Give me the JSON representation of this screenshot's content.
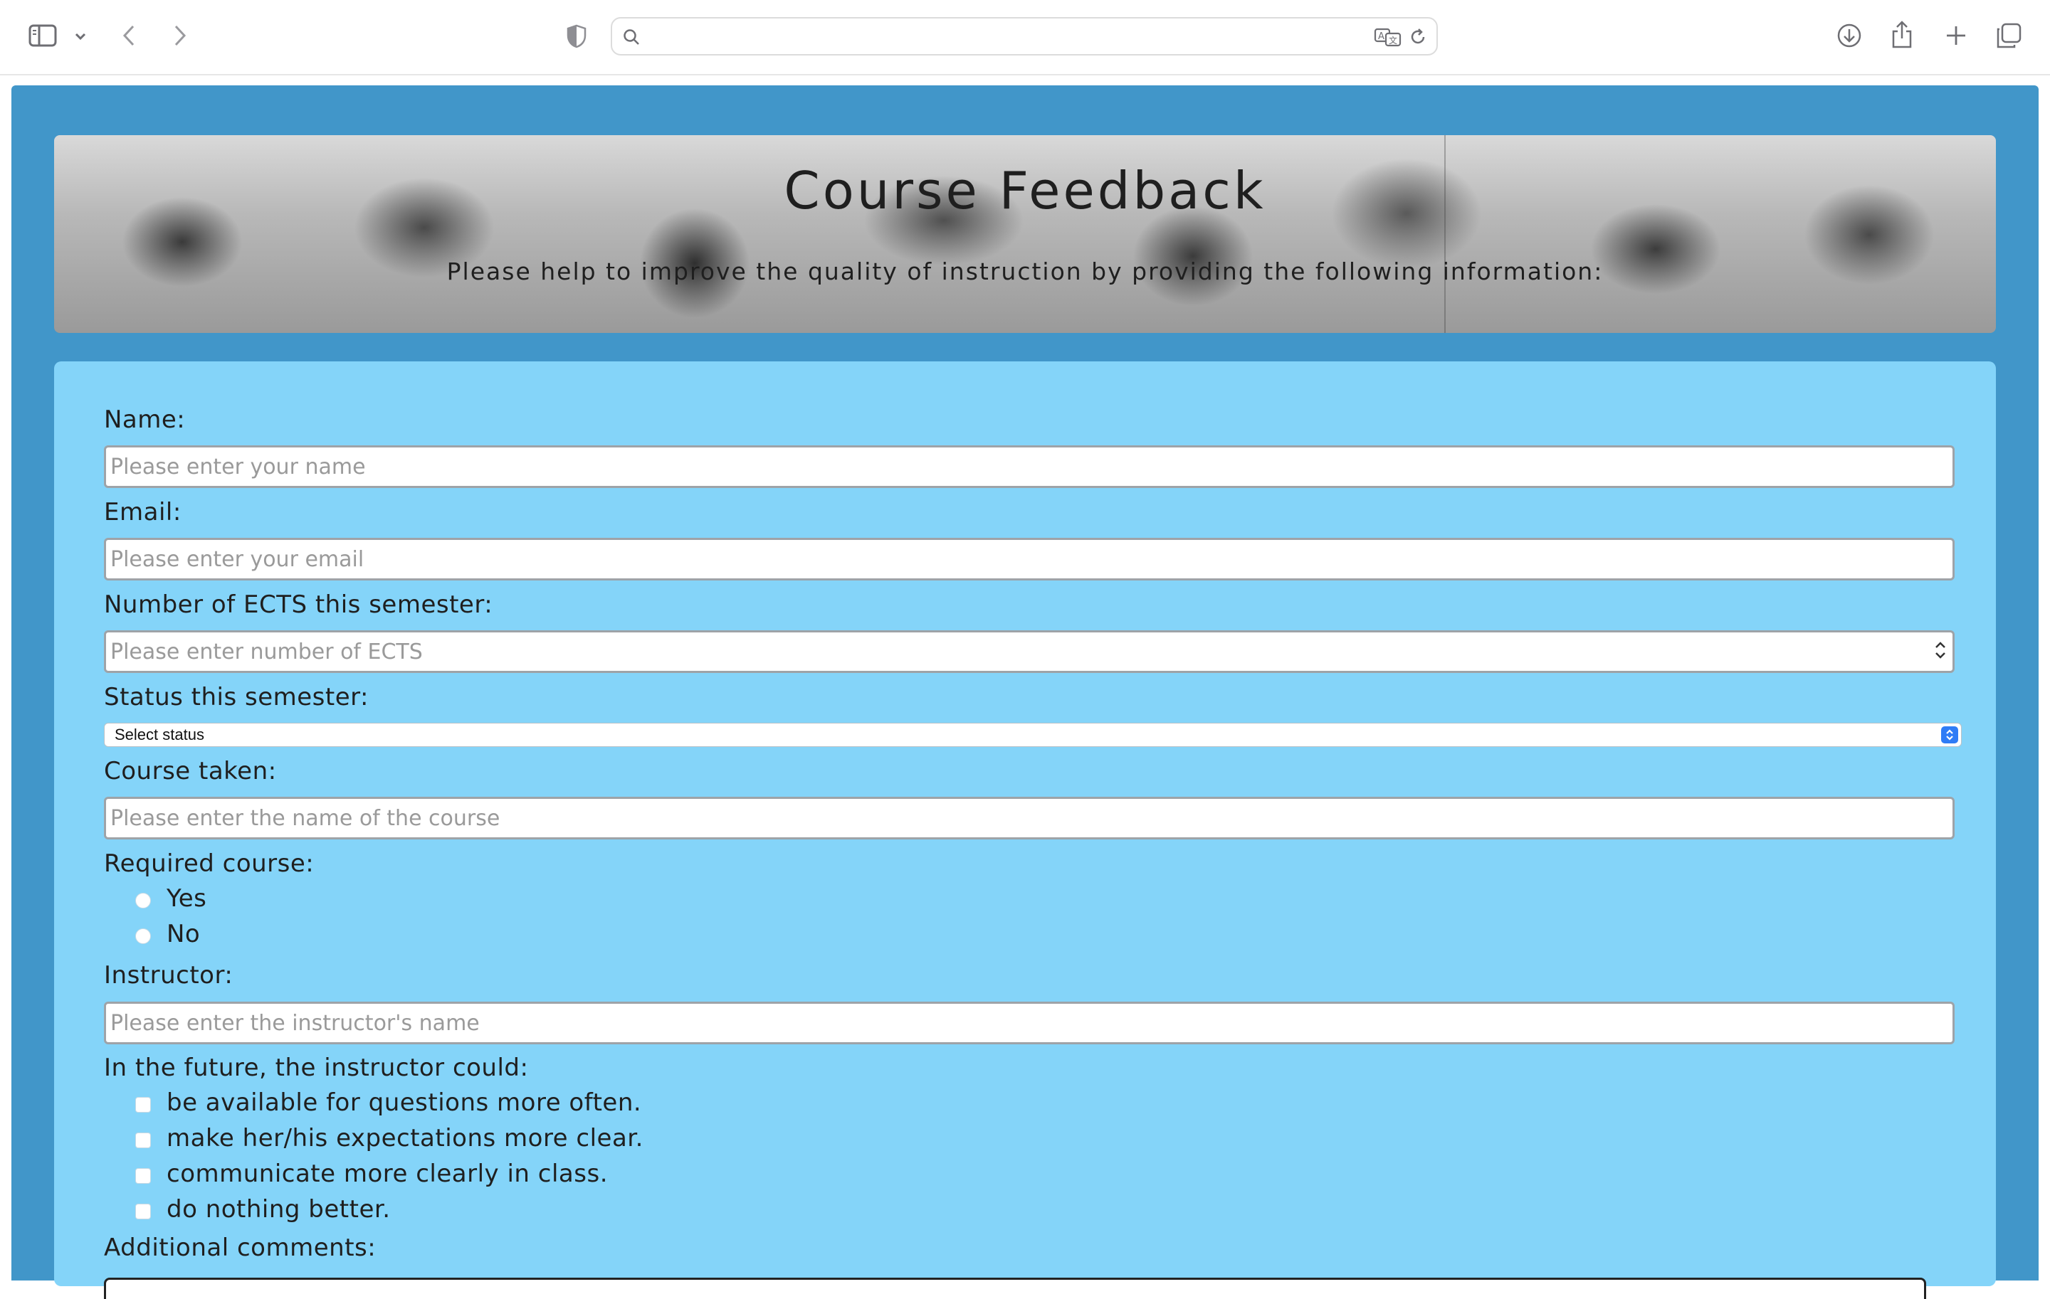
{
  "browser": {
    "address_value": "",
    "icons": [
      "sidebar-icon",
      "chevron-down-icon",
      "back-icon",
      "forward-icon",
      "shield-icon",
      "search-icon",
      "translate-icon",
      "reload-icon",
      "download-icon",
      "share-icon",
      "plus-icon",
      "tabs-icon"
    ]
  },
  "header": {
    "title": "Course Feedback",
    "subtitle": "Please help to improve the quality of instruction by providing the following information:"
  },
  "form": {
    "name": {
      "label": "Name:",
      "placeholder": "Please enter your name"
    },
    "email": {
      "label": "Email:",
      "placeholder": "Please enter your email"
    },
    "ects": {
      "label": "Number of ECTS this semester:",
      "placeholder": "Please enter number of ECTS"
    },
    "status": {
      "label": "Status this semester:",
      "selected": "Select status"
    },
    "course": {
      "label": "Course taken:",
      "placeholder": "Please enter the name of the course"
    },
    "required": {
      "label": "Required course:",
      "options": [
        "Yes",
        "No"
      ]
    },
    "instructor": {
      "label": "Instructor:",
      "placeholder": "Please enter the instructor's name"
    },
    "future": {
      "label": "In the future, the instructor could:",
      "options": [
        "be available for questions more often.",
        "make her/his expectations more clear.",
        "communicate more clearly in class.",
        "do nothing better."
      ]
    },
    "comments": {
      "label": "Additional comments:"
    }
  },
  "colors": {
    "page_bg": "#4196c9",
    "form_bg": "#84d4f9",
    "select_accent": "#2f7cf6"
  }
}
